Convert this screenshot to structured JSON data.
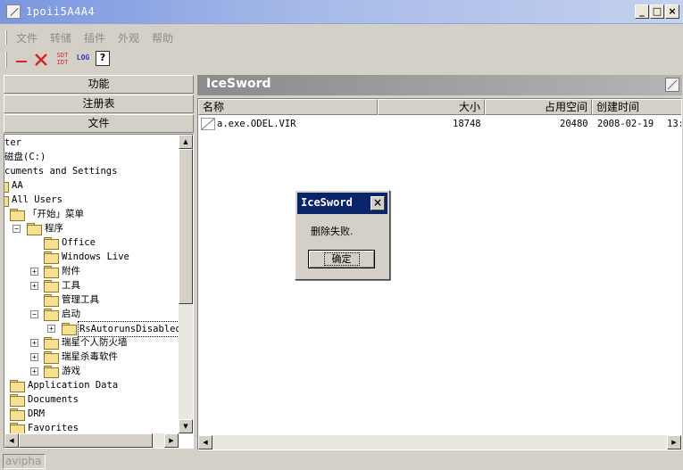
{
  "window": {
    "title": "1poii5A4A4"
  },
  "menu": [
    "文件",
    "转储",
    "插件",
    "外观",
    "帮助"
  ],
  "toolbar": {
    "buttons": [
      {
        "icon": "minus-icon",
        "color": "#cc2a2a"
      },
      {
        "icon": "close-x-icon",
        "color": "#d62424"
      },
      {
        "label_top": "SDT",
        "label_bottom": "IDT",
        "color": "#cc2a2a"
      },
      {
        "label": "LOG",
        "color": "#2a3cc0"
      },
      {
        "icon": "help-icon",
        "label": "?"
      }
    ]
  },
  "left_panel": {
    "buttons": [
      "功能",
      "注册表",
      "文件"
    ],
    "tree": [
      {
        "label": "ter"
      },
      {
        "label": "磁盘(C:)"
      },
      {
        "label": "cuments and Settings"
      },
      {
        "label": "AA"
      },
      {
        "label": "All Users"
      },
      {
        "label": "「开始」菜单"
      },
      {
        "label": "程序"
      },
      {
        "label": "Office"
      },
      {
        "label": "Windows Live"
      },
      {
        "label": "附件"
      },
      {
        "label": "工具"
      },
      {
        "label": "管理工具"
      },
      {
        "label": "启动"
      },
      {
        "label": "RsAutorunsDisabled"
      },
      {
        "label": "瑞星个人防火墙"
      },
      {
        "label": "瑞星杀毒软件"
      },
      {
        "label": "游戏"
      },
      {
        "label": "Application Data"
      },
      {
        "label": "Documents"
      },
      {
        "label": "DRM"
      },
      {
        "label": "Favorites"
      }
    ]
  },
  "right_panel": {
    "title": "IceSword",
    "columns": [
      "名称",
      "大小",
      "占用空间",
      "创建时间"
    ],
    "rows": [
      {
        "name": "a.exe.ODEL.VIR",
        "size": "18748",
        "allocated": "20480",
        "date": "2008-02-19",
        "time": "13:"
      }
    ]
  },
  "dialog": {
    "title": "IceSword",
    "message": "删除失败.",
    "ok_label": "确定",
    "close_label": "×"
  },
  "statusbar": {
    "text": "avipha"
  },
  "colors": {
    "title_gradient_start": "#7a96df",
    "dialog_title": "#0a246a",
    "panel_header": "#8b8b8b"
  }
}
